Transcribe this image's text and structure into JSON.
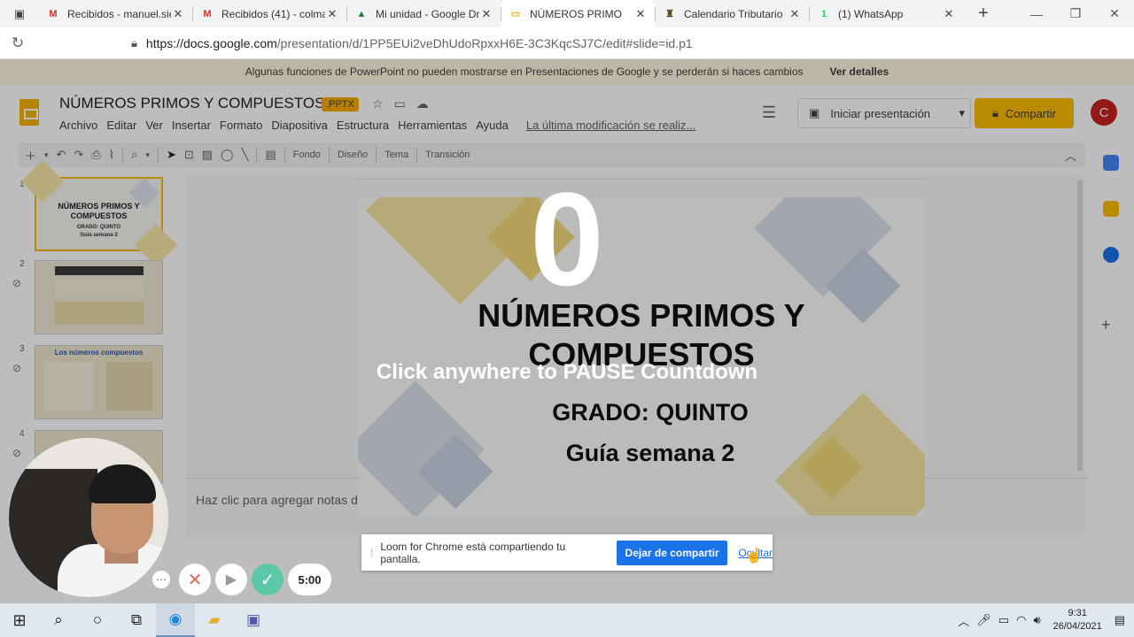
{
  "browser": {
    "tabs": [
      {
        "title": "Recibidos - manuel.sie",
        "favicon": "gmail-icon",
        "color": "#d93025",
        "glyph": "M",
        "active": false
      },
      {
        "title": "Recibidos (41) - colma",
        "favicon": "gmail-icon",
        "color": "#d93025",
        "glyph": "M",
        "active": false
      },
      {
        "title": "Mi unidad - Google Dr",
        "favicon": "drive-icon",
        "color": "#188038",
        "glyph": "▲",
        "active": false
      },
      {
        "title": "NÚMEROS PRIMO",
        "favicon": "slides-icon",
        "color": "#f4b400",
        "glyph": "▭",
        "active": true
      },
      {
        "title": "Calendario Tributario",
        "favicon": "calendar-site-icon",
        "color": "#5d4a1f",
        "glyph": "♜",
        "active": false
      },
      {
        "title": "(1) WhatsApp",
        "favicon": "whatsapp-icon",
        "color": "#25d366",
        "glyph": "1",
        "active": false
      }
    ],
    "url_host": "https://docs.google.com",
    "url_path": "/presentation/d/1PP5EUi2veDhUdoRpxxH6E-3C3KqcSJ7C/edit#slide=id.p1"
  },
  "app": {
    "banner_text": "Algunas funciones de PowerPoint no pueden mostrarse en Presentaciones de Google y se perderán si haces cambios",
    "banner_link": "Ver detalles",
    "doc_title": "NÚMEROS  PRIMOS Y  COMPUESTOS",
    "file_badge": ".PPTX",
    "menu": [
      "Archivo",
      "Editar",
      "Ver",
      "Insertar",
      "Formato",
      "Diapositiva",
      "Estructura",
      "Herramientas",
      "Ayuda"
    ],
    "last_edit": "La última modificación se realiz...",
    "present_label": "Iniciar presentación",
    "share_label": "Compartir",
    "user_initial": "C",
    "toolbar_labels": [
      "Fondo",
      "Diseño",
      "Tema",
      "Transición"
    ],
    "notes_placeholder": "Haz clic para agregar notas de"
  },
  "slides": [
    {
      "num": "1",
      "title": "NÚMEROS  PRIMOS Y COMPUESTOS",
      "line1": "GRADO: QUINTO",
      "line2": "Guía semana 2"
    },
    {
      "num": "2"
    },
    {
      "num": "3",
      "title": "Los números compuestos"
    },
    {
      "num": "4"
    }
  ],
  "main_slide": {
    "title_line1": "NÚMEROS  PRIMOS Y",
    "title_line2": "COMPUESTOS",
    "subtitle1": "GRADO: QUINTO",
    "subtitle2": "Guía semana 2"
  },
  "loom": {
    "countdown": "0",
    "pause_message": "Click anywhere to PAUSE Countdown",
    "sharing_text": "Loom for Chrome está compartiendo tu pantalla.",
    "stop_label": "Dejar de compartir",
    "hide_label": "Ocultar",
    "timer": "5:00"
  },
  "taskbar": {
    "time": "9:31",
    "date": "26/04/2021"
  },
  "colors": {
    "accent_yellow": "#fbbc04",
    "loom_blue": "#1a73e8",
    "loom_green": "#5cc8a8"
  }
}
